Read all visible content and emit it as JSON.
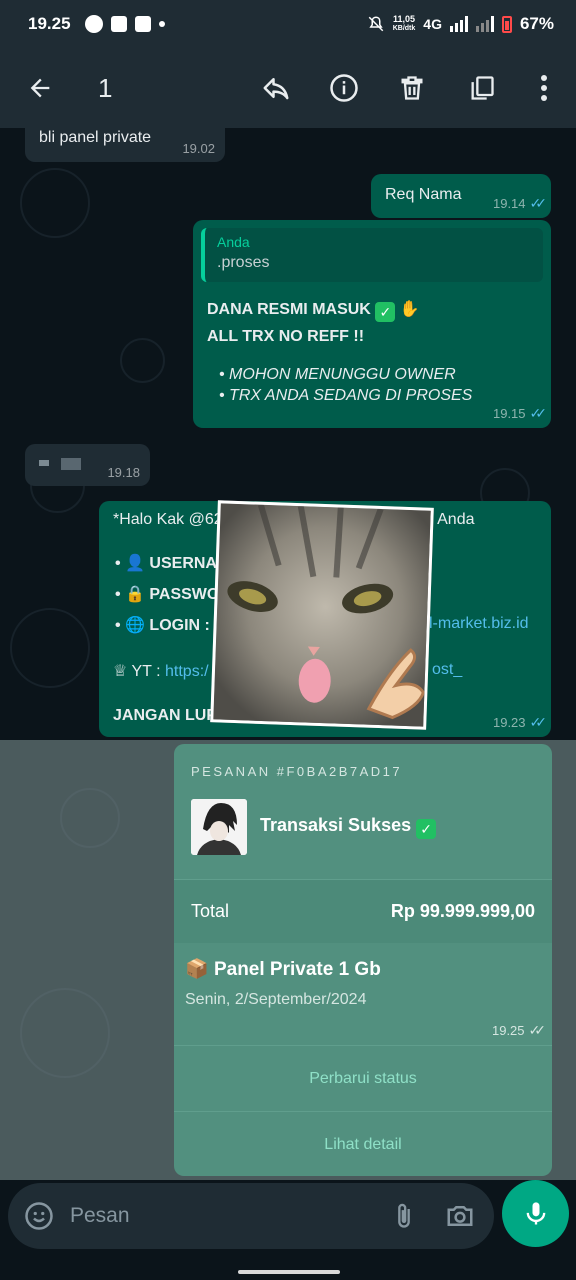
{
  "status_bar": {
    "time": "19.25",
    "speed_value": "11,05",
    "speed_unit": "KB/dtk",
    "network": "4G",
    "battery": "67%"
  },
  "app_bar": {
    "selected_count": "1"
  },
  "messages": [
    {
      "text": "bli panel private",
      "time": "19.02"
    },
    {
      "text": "Req Nama",
      "time": "19.14"
    },
    {
      "quote_author": "Anda",
      "quote_text": ".proses",
      "line1": "DANA RESMI MASUK",
      "line2": "ALL TRX NO REFF !!",
      "bullet1": "• MOHON MENUNGGU OWNER",
      "bullet2": "• TRX ANDA SEDANG DI PROSES",
      "time": "19.15"
    },
    {
      "time": "19.18"
    },
    {
      "greeting_start": "*Halo Kak @62",
      "greeting_end": "l Anda",
      "user_label": "USERNA",
      "pass_label": "PASSWO",
      "login_label": "LOGIN :",
      "login_domain": "l-market.biz.id",
      "yt_label": "YT :",
      "yt_link_start": "https:/",
      "yt_link_end": "ost_",
      "footer": "JANGAN LUP",
      "time": "19.23"
    }
  ],
  "order": {
    "header": "PESANAN #F0BA2B7AD17",
    "status": "Transaksi Sukses",
    "total_label": "Total",
    "total_amount": "Rp 99.999.999,00",
    "product": "Panel Private 1 Gb",
    "date": "Senin, 2/September/2024",
    "time": "19.25",
    "update_button": "Perbarui status",
    "detail_button": "Lihat detail"
  },
  "composer": {
    "placeholder": "Pesan"
  },
  "colors": {
    "header": "#1f2c34",
    "outgoing": "#005c4b",
    "incoming": "#1f2c34",
    "accent": "#00a884",
    "read_ticks": "#53bdeb"
  }
}
